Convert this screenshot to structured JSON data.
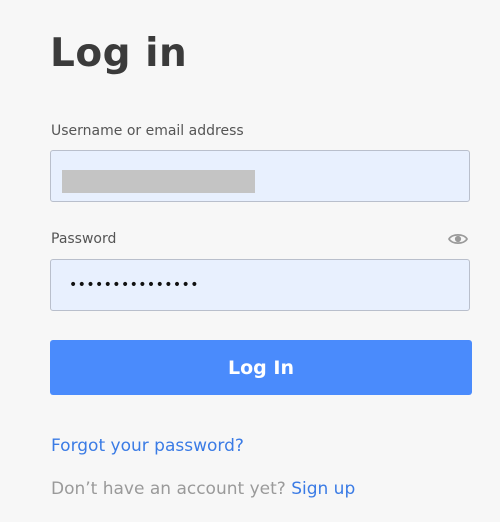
{
  "form": {
    "title": "Log in",
    "username_label": "Username or email address",
    "username_value": "",
    "password_label": "Password",
    "password_dots": "•••••••••••••••",
    "show_password_icon": "eye-icon",
    "submit_label": "Log In"
  },
  "links": {
    "forgot_password": "Forgot your password?",
    "no_account_text": "Don’t have an account yet?",
    "sign_up": "Sign up"
  },
  "colors": {
    "background": "#f7f7f7",
    "input_background": "#e8f0fe",
    "button": "#4a8bfc",
    "link": "#3a7be5",
    "redaction": "#c4c4c4"
  }
}
